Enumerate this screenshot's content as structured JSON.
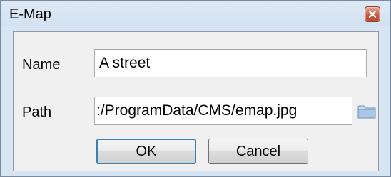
{
  "window": {
    "title": "E-Map"
  },
  "form": {
    "name_label": "Name",
    "name_value": "A street",
    "path_label": "Path",
    "path_value": ":/ProgramData/CMS/emap.jpg"
  },
  "buttons": {
    "ok": "OK",
    "cancel": "Cancel"
  },
  "icons": {
    "close": "close-icon",
    "browse": "folder-icon"
  },
  "colors": {
    "close_button": "#c85a40",
    "titlebar": "#d7e4f2",
    "client": "#f0f0f0"
  }
}
